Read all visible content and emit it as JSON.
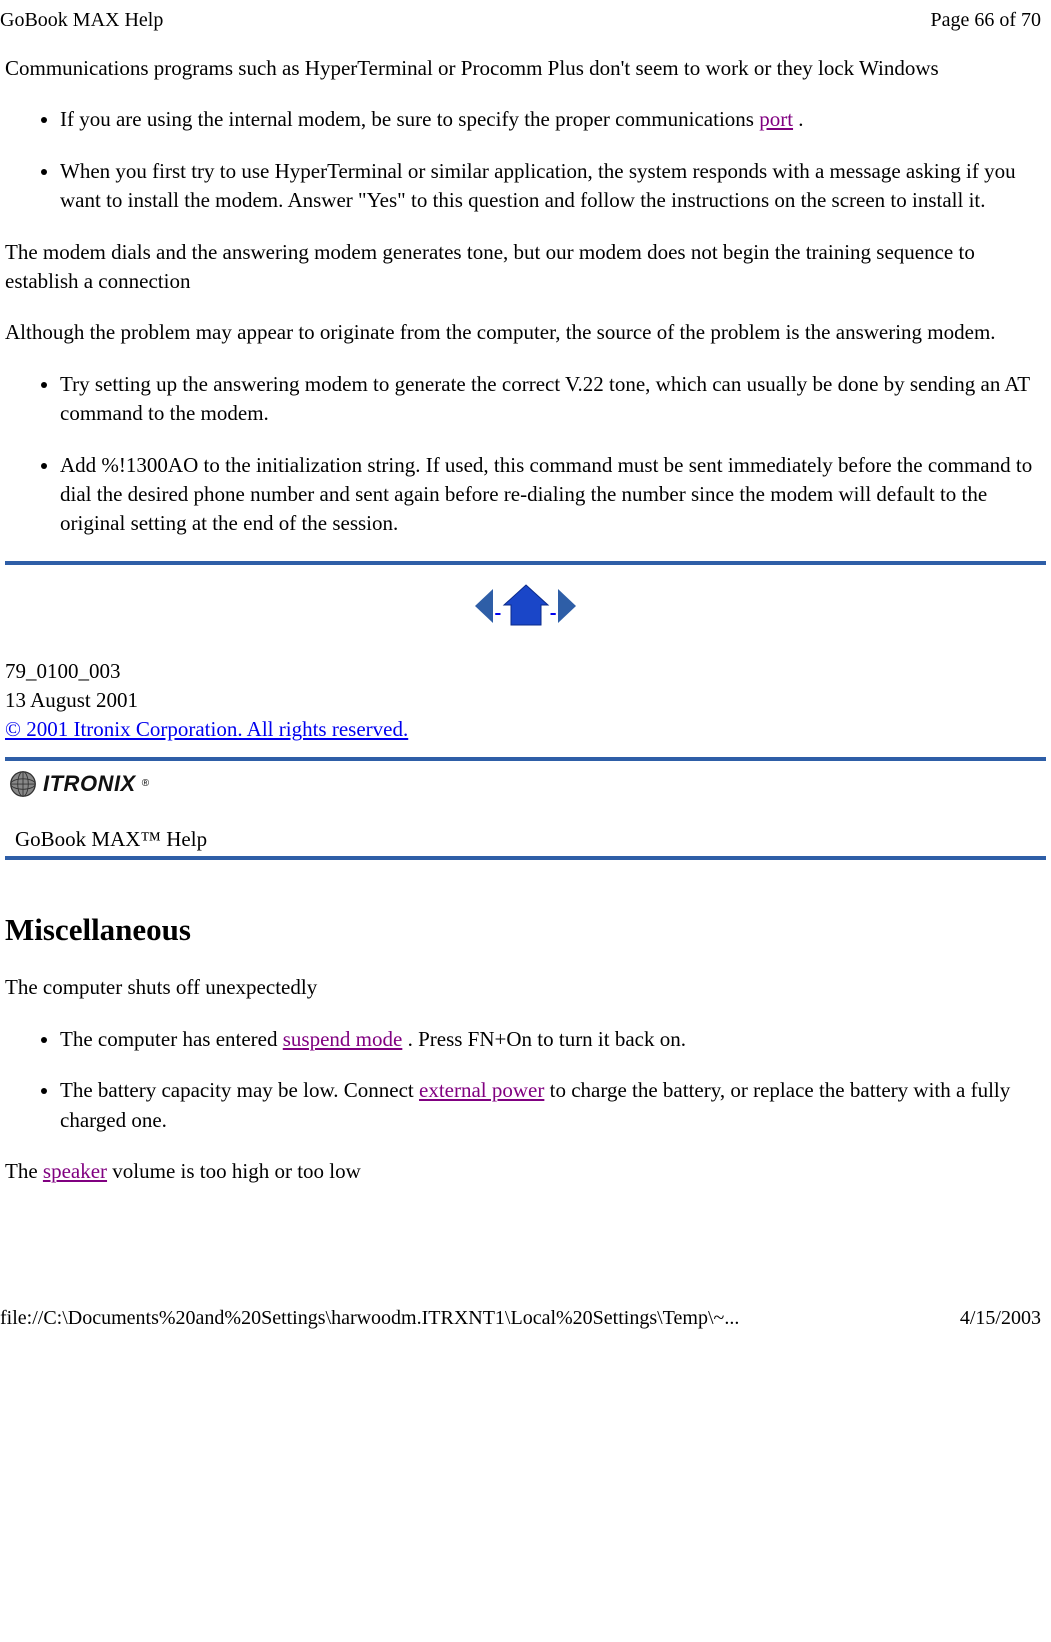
{
  "header": {
    "title": "GoBook MAX Help",
    "page_info": "Page 66 of 70"
  },
  "body": {
    "p1": "Communications programs such as HyperTerminal or Procomm Plus don't seem to work or they lock Windows",
    "li1_prefix": "If you are using the internal modem, be sure to specify the proper communications ",
    "li1_link": "port",
    "li1_suffix": " .",
    "li2": "When you first try to use HyperTerminal or similar application, the system responds with a message asking if you want to install the modem. Answer \"Yes\" to this question and follow the instructions on the screen to install it.",
    "p2": "The modem dials and the answering modem generates tone, but our modem does not begin the training sequence to establish a connection",
    "p3": "Although the problem may appear to originate from the computer, the source of the problem is the answering modem.",
    "li3": "Try setting up the answering modem to generate the correct V.22 tone, which can usually be done by sending an AT command to the modem.",
    "li4": "Add %!1300AO to the initialization string. If used, this command must be sent immediately before the command to dial the desired phone number and sent again before re-dialing the number since the modem will default to the original setting at the end of the session."
  },
  "nav": {
    "prev": "previous-page-icon",
    "home": "home-icon",
    "next": "next-page-icon"
  },
  "meta": {
    "doc_num": "79_0100_003",
    "doc_date": "13 August 2001",
    "copyright": "© 2001 Itronix Corporation.  All rights reserved."
  },
  "brand": {
    "name": "ITRONIX",
    "help_line": "GoBook MAX™ Help"
  },
  "misc": {
    "heading": "Miscellaneous",
    "p1": "The computer shuts off unexpectedly",
    "li1_prefix": "The computer has entered ",
    "li1_link": "suspend mode",
    "li1_suffix": " . Press FN+On to turn it back on.",
    "li2_prefix": "The battery capacity may be low. Connect ",
    "li2_link": "external power",
    "li2_suffix": " to charge the battery, or replace the battery with a fully charged one.",
    "p2_prefix": "The ",
    "p2_link": "speaker",
    "p2_suffix": " volume is too high or too low"
  },
  "footer": {
    "path": "file://C:\\Documents%20and%20Settings\\harwoodm.ITRXNT1\\Local%20Settings\\Temp\\~...",
    "date": "4/15/2003"
  }
}
